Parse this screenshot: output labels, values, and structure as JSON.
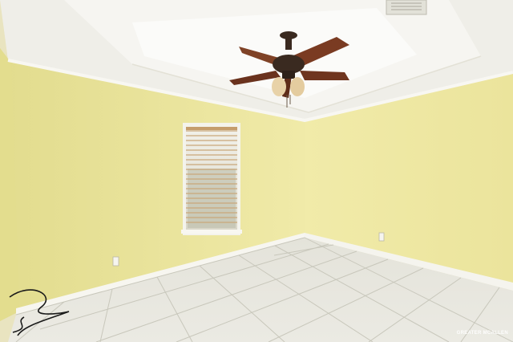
{
  "scene": {
    "colors": {
      "wall_left": "#ece6a0",
      "wall_right": "#efe9a8",
      "ceiling": "#f4f3ee",
      "tray": "#fafaf8",
      "trim": "#f7f6f0",
      "floor": "#e6e5dc",
      "grout": "#c9c8bd",
      "fan_body": "#3a2a20",
      "fan_blade": "#7a3b22",
      "light_glass": "#e8d2a8"
    },
    "objects": [
      {
        "name": "ceiling-fan",
        "icon": "ceiling-fan-icon"
      },
      {
        "name": "window-with-blinds",
        "icon": "window-icon"
      },
      {
        "name": "ceiling-vent",
        "icon": "vent-icon"
      },
      {
        "name": "electrical-outlet",
        "icon": "outlet-icon"
      },
      {
        "name": "loose-cable",
        "icon": "cable-icon"
      }
    ]
  },
  "watermark": {
    "text": "GREATER MCALLEN"
  }
}
